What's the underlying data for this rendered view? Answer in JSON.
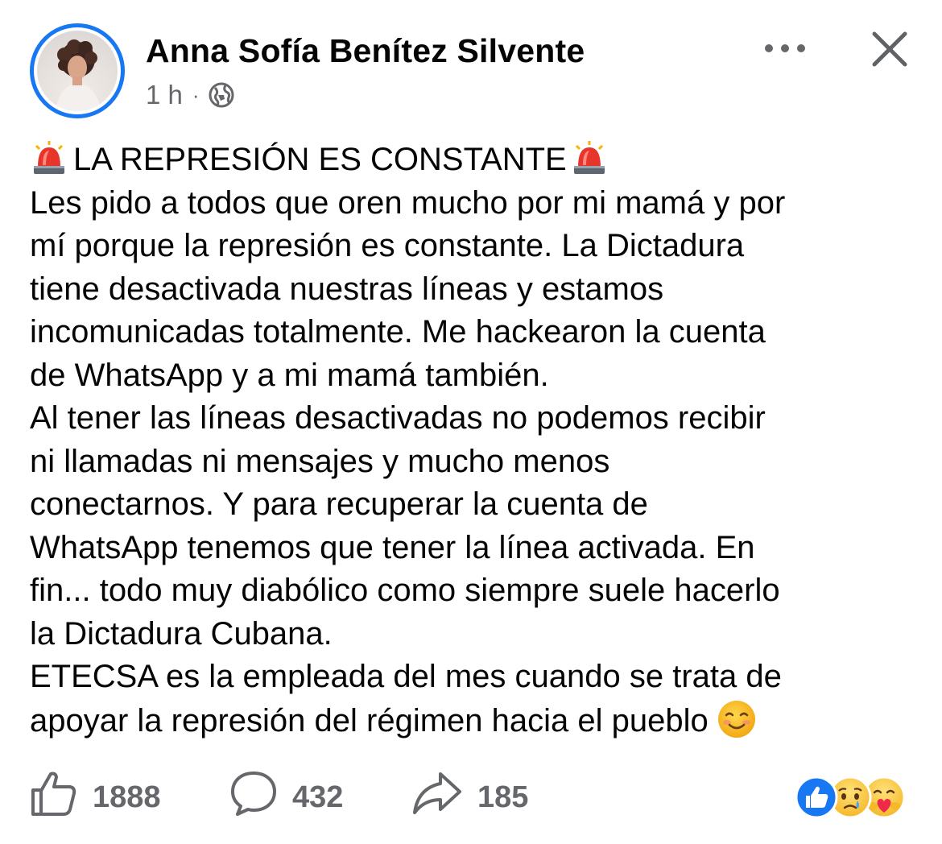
{
  "post": {
    "author_name": "Anna Sofía Benítez Silvente",
    "time": "1 h",
    "separator": "·",
    "privacy_icon": "globe-icon",
    "more_icon": "more-options-icon",
    "close_icon": "close-icon",
    "headline": "LA REPRESIÓN ES CONSTANTE",
    "headline_icon": "police-siren-emoji",
    "lines": [
      "Les pido a todos que oren mucho por mi mamá y por",
      "mí porque la represión es constante. La Dictadura",
      "tiene desactivada nuestras líneas y estamos",
      "incomunicadas totalmente. Me hackearon la cuenta",
      "de WhatsApp y a mi mamá también.",
      "Al tener las líneas desactivadas no podemos recibir",
      "ni llamadas ni mensajes y mucho menos",
      "conectarnos. Y para recuperar la cuenta de",
      "WhatsApp tenemos que tener la línea activada. En",
      "fin... todo muy diabólico como siempre suele hacerlo",
      "la Dictadura Cubana.",
      "ETECSA es la empleada del mes cuando se trata de"
    ],
    "last_line": "apoyar la represión del régimen hacia el pueblo",
    "last_line_emoji": "smiling-face-emoji"
  },
  "footer": {
    "likes": "1888",
    "comments": "432",
    "shares": "185",
    "reactions": [
      "like-reaction-icon",
      "sad-reaction-icon",
      "care-reaction-icon"
    ]
  },
  "colors": {
    "accent": "#1877f2",
    "text": "#050505",
    "secondary": "#65676b"
  }
}
